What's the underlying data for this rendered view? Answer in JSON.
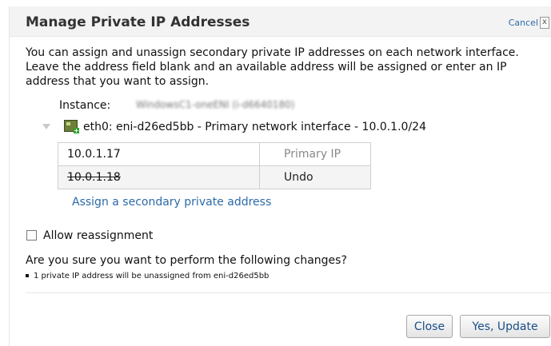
{
  "dialog": {
    "title": "Manage Private IP Addresses",
    "cancel_label": "Cancel",
    "close_glyph": "x",
    "description": "You can assign and unassign secondary private IP addresses on each network interface. Leave the address field blank and an available address will be assigned or enter an IP address that you want to assign."
  },
  "instance": {
    "label": "Instance:",
    "value": "WindowsC1-oneENI (i-d6640180)"
  },
  "interface": {
    "label": "eth0: eni-d26ed5bb - Primary network interface - 10.0.1.0/24",
    "icon": "network-interface-icon",
    "addresses": [
      {
        "ip": "10.0.1.17",
        "status": "Primary IP"
      },
      {
        "ip": "10.0.1.18",
        "status": "Undo"
      }
    ],
    "assign_link": "Assign a secondary private address"
  },
  "reassignment": {
    "label": "Allow reassignment",
    "checked": false
  },
  "confirm": {
    "question": "Are you sure you want to perform the following changes?",
    "changes": [
      "1 private IP address will be unassigned from eni-d26ed5bb"
    ]
  },
  "buttons": {
    "close": "Close",
    "update": "Yes, Update"
  }
}
